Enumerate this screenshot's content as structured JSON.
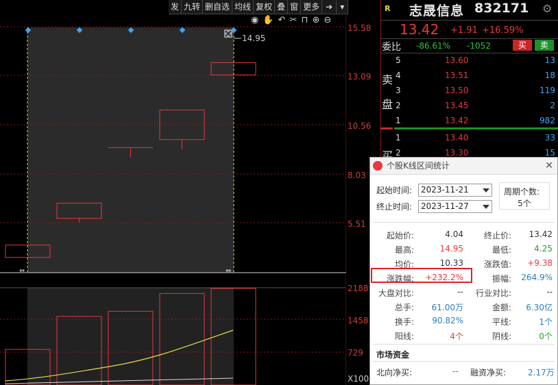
{
  "toolbar": {
    "items": [
      "发",
      "九转",
      "删自选",
      "均线",
      "复权",
      "叠",
      "窗",
      "更多"
    ]
  },
  "kline": {
    "price_axis": [
      "15.58",
      "13.09",
      "10.56",
      "8.03",
      "5.51"
    ],
    "range_high_label": "14.95",
    "candles": [
      {
        "open": 4.04,
        "close": 4.04
      },
      {
        "open": 6.51,
        "close": 5.73
      },
      {
        "open": 9.37,
        "close": 9.37
      },
      {
        "open": 11.3,
        "close": 9.78
      },
      {
        "open": 13.42,
        "close": 13.42
      }
    ]
  },
  "volume": {
    "axis": [
      "2188",
      "1458",
      "729",
      "X100"
    ],
    "bars": [
      1.4,
      2.7,
      2.9,
      3.6,
      3.8
    ]
  },
  "quote": {
    "flag": "R",
    "name": "志晟信息",
    "code": "832171",
    "price": "13.42",
    "change": "+1.91",
    "change_pct": "+16.59%",
    "weibi_label": "委比",
    "weibi": "-86.61%",
    "weicha": "-1052",
    "buy_btn": "买",
    "sell_btn": "卖",
    "sell_side_label": [
      "卖",
      "盘"
    ],
    "buy_side_label": "买",
    "asks": [
      {
        "level": "5",
        "price": "13.60",
        "vol": "13"
      },
      {
        "level": "4",
        "price": "13.51",
        "vol": "18"
      },
      {
        "level": "3",
        "price": "13.50",
        "vol": "119"
      },
      {
        "level": "2",
        "price": "13.45",
        "vol": "2"
      },
      {
        "level": "1",
        "price": "13.42",
        "vol": "982"
      }
    ],
    "bids": [
      {
        "level": "1",
        "price": "13.40",
        "vol": "33"
      },
      {
        "level": "2",
        "price": "13.30",
        "vol": "15"
      }
    ]
  },
  "dialog": {
    "title": "个股K线区间统计",
    "start_label": "起始时间:",
    "start_value": "2023-11-21",
    "end_label": "终止时间:",
    "end_value": "2023-11-27",
    "period_label": "周期个数:",
    "period_value": "5个",
    "stats": [
      {
        "l": "起始价:",
        "v": "4.04",
        "lc": "dark",
        "r": "终止价:",
        "rv": "13.42",
        "rc": "dark"
      },
      {
        "l": "最高:",
        "v": "14.95",
        "lc": "red",
        "r": "最低:",
        "rv": "4.25",
        "rc": "green"
      },
      {
        "l": "均价:",
        "v": "10.33",
        "lc": "dark",
        "r": "涨跌值:",
        "rv": "+9.38",
        "rc": "red"
      },
      {
        "l": "涨跌幅:",
        "v": "+232.2%",
        "lc": "red",
        "r": "振幅:",
        "rv": "264.9%",
        "rc": "blue"
      },
      {
        "l": "大盘对比:",
        "v": "--",
        "lc": "dark",
        "r": "行业对比:",
        "rv": "--",
        "rc": "dark"
      },
      {
        "l": "总手:",
        "v": "61.00万",
        "lc": "blue",
        "r": "金额:",
        "rv": "6.30亿",
        "rc": "blue"
      },
      {
        "l": "换手:",
        "v": "90.82%",
        "lc": "blue",
        "r": "平线:",
        "rv": "1个",
        "rc": "blue"
      },
      {
        "l": "阳线:",
        "v": "4个",
        "lc": "red",
        "r": "阴线:",
        "rv": "0个",
        "rc": "green"
      }
    ],
    "market_title": "市场资金",
    "north_label": "北向净买:",
    "north_value": "--",
    "margin_label": "融资净买:",
    "margin_value": "2.17万"
  },
  "colors": {
    "up": "#e8383d",
    "down": "#2a9d2a",
    "grid": "#8b1a1a",
    "selection": "#2b2b2b",
    "marker": "#3aa6ff",
    "highlight_box": "#e02020"
  }
}
